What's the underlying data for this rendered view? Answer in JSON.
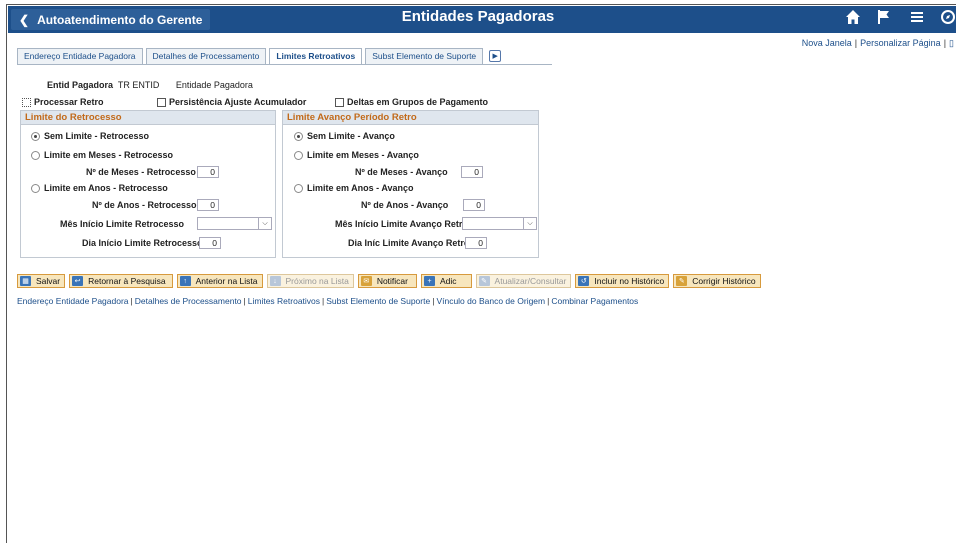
{
  "header": {
    "back_label": "Autoatendimento do Gerente",
    "title": "Entidades Pagadoras",
    "icons": [
      "home-icon",
      "flag-icon",
      "menu-icon",
      "navbar-icon"
    ]
  },
  "top_links": [
    "Nova Janela",
    "Personalizar Página"
  ],
  "tabs": [
    {
      "label": "Endereço Entidade Pagadora",
      "active": false
    },
    {
      "label": "Detalhes de Processamento",
      "active": false
    },
    {
      "label": "Limites Retroativos",
      "active": true
    },
    {
      "label": "Subst Elemento de Suporte",
      "active": false
    }
  ],
  "entity": {
    "label": "Entid Pagadora",
    "code": "TR ENTID",
    "description": "Entidade Pagadora"
  },
  "options": {
    "processar_retro": "Processar Retro",
    "persistencia": "Persistência Ajuste Acumulador",
    "deltas": "Deltas em Grupos de Pagamento"
  },
  "left_panel": {
    "title": "Limite do Retrocesso",
    "radio_sem": "Sem Limite - Retrocesso",
    "radio_meses": "Limite em Meses - Retrocesso",
    "meses_label": "Nº de Meses - Retrocesso",
    "meses_value": "0",
    "radio_anos": "Limite em Anos - Retrocesso",
    "anos_label": "Nº de Anos - Retrocesso",
    "anos_value": "0",
    "mes_inicio_label": "Mês Início Limite Retrocesso",
    "dia_inicio_label": "Dia Início Limite Retrocesso",
    "dia_inicio_value": "0"
  },
  "right_panel": {
    "title": "Limite Avanço Período Retro",
    "radio_sem": "Sem Limite - Avanço",
    "radio_meses": "Limite em Meses - Avanço",
    "meses_label": "Nº de Meses - Avanço",
    "meses_value": "0",
    "radio_anos": "Limite em Anos - Avanço",
    "anos_label": "Nº de Anos - Avanço",
    "anos_value": "0",
    "mes_inicio_label": "Mês Início Limite Avanço Retro",
    "dia_inicio_label": "Dia Iníc Limite Avanço Retro",
    "dia_inicio_value": "0"
  },
  "toolbar": {
    "save": "Salvar",
    "return": "Retornar à Pesquisa",
    "previous": "Anterior na Lista",
    "next": "Próximo na Lista",
    "notify": "Notificar",
    "add": "Adic",
    "update": "Atualizar/Consultar",
    "history": "Incluir no Histórico",
    "correct": "Corrigir Histórico"
  },
  "bottom_links": [
    "Endereço Entidade Pagadora",
    "Detalhes de Processamento",
    "Limites Retroativos",
    "Subst Elemento de Suporte",
    "Vínculo do Banco de Origem",
    "Combinar Pagamentos"
  ],
  "colors": {
    "banner": "#1d4f8a",
    "panel_title": "#c26a1a",
    "link": "#1d4f8a",
    "button_bg": "#f7e6bd"
  }
}
